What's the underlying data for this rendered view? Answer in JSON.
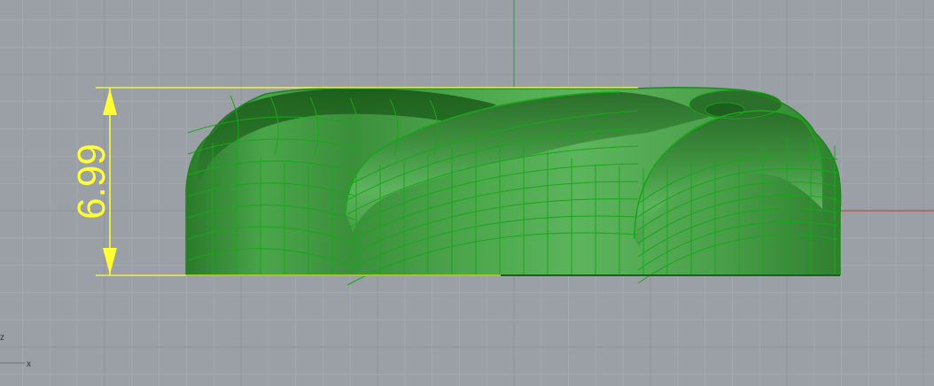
{
  "viewport": {
    "view": "Front",
    "background_color": "#9aa0a6",
    "grid_minor_color": "#a3a9af",
    "grid_major_color": "#8f959b",
    "world_x_axis_color": "#c03a2b",
    "world_y_axis_color": "#2e9b3a"
  },
  "model": {
    "object": "twisted-torus-polysurface",
    "render_mode": "shaded",
    "base_color": "#3f9a3f",
    "shadow_color": "#1f6a1f",
    "highlight_color": "#6cc56c",
    "wire_color": "#17a817"
  },
  "dimension": {
    "value": "6.99",
    "color": "#ffff33",
    "orientation": "vertical"
  },
  "axis_gizmo": {
    "z_label": "z",
    "x_label": "x"
  }
}
